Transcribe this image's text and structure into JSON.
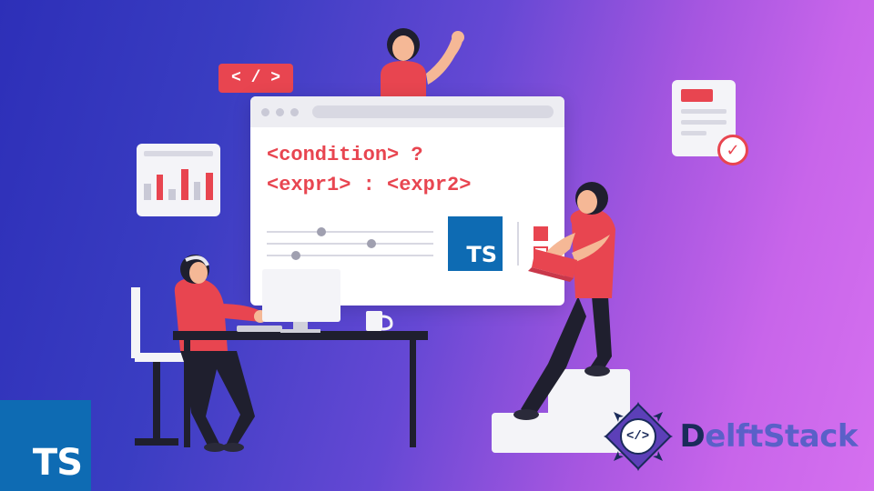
{
  "code_tag": "< / >",
  "browser": {
    "line1": "<condition> ?",
    "line2": "<expr1> : <expr2>",
    "ts_label": "TS"
  },
  "ts_corner": "TS",
  "brand": {
    "glyph": "</>",
    "first_letter": "D",
    "rest": "elftStack"
  },
  "check_mark": "✓"
}
